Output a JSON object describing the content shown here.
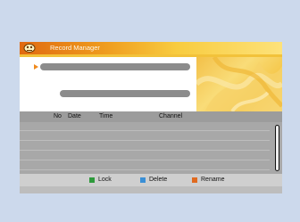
{
  "header": {
    "title": "Record Manager"
  },
  "list": {
    "columns": {
      "no": "No",
      "date": "Date",
      "time": "Time",
      "channel": "Channel"
    },
    "rows": []
  },
  "footer": {
    "lock": {
      "label": "Lock",
      "color": "#2e9a3c"
    },
    "delete": {
      "label": "Delete",
      "color": "#3a8fd6"
    },
    "rename": {
      "label": "Rename",
      "color": "#e06a20"
    }
  },
  "colors": {
    "background": "#ccd9ec",
    "header_orange": "#e06a10",
    "header_yellow": "#f8cc40",
    "list_gray": "#a8a8a8"
  }
}
